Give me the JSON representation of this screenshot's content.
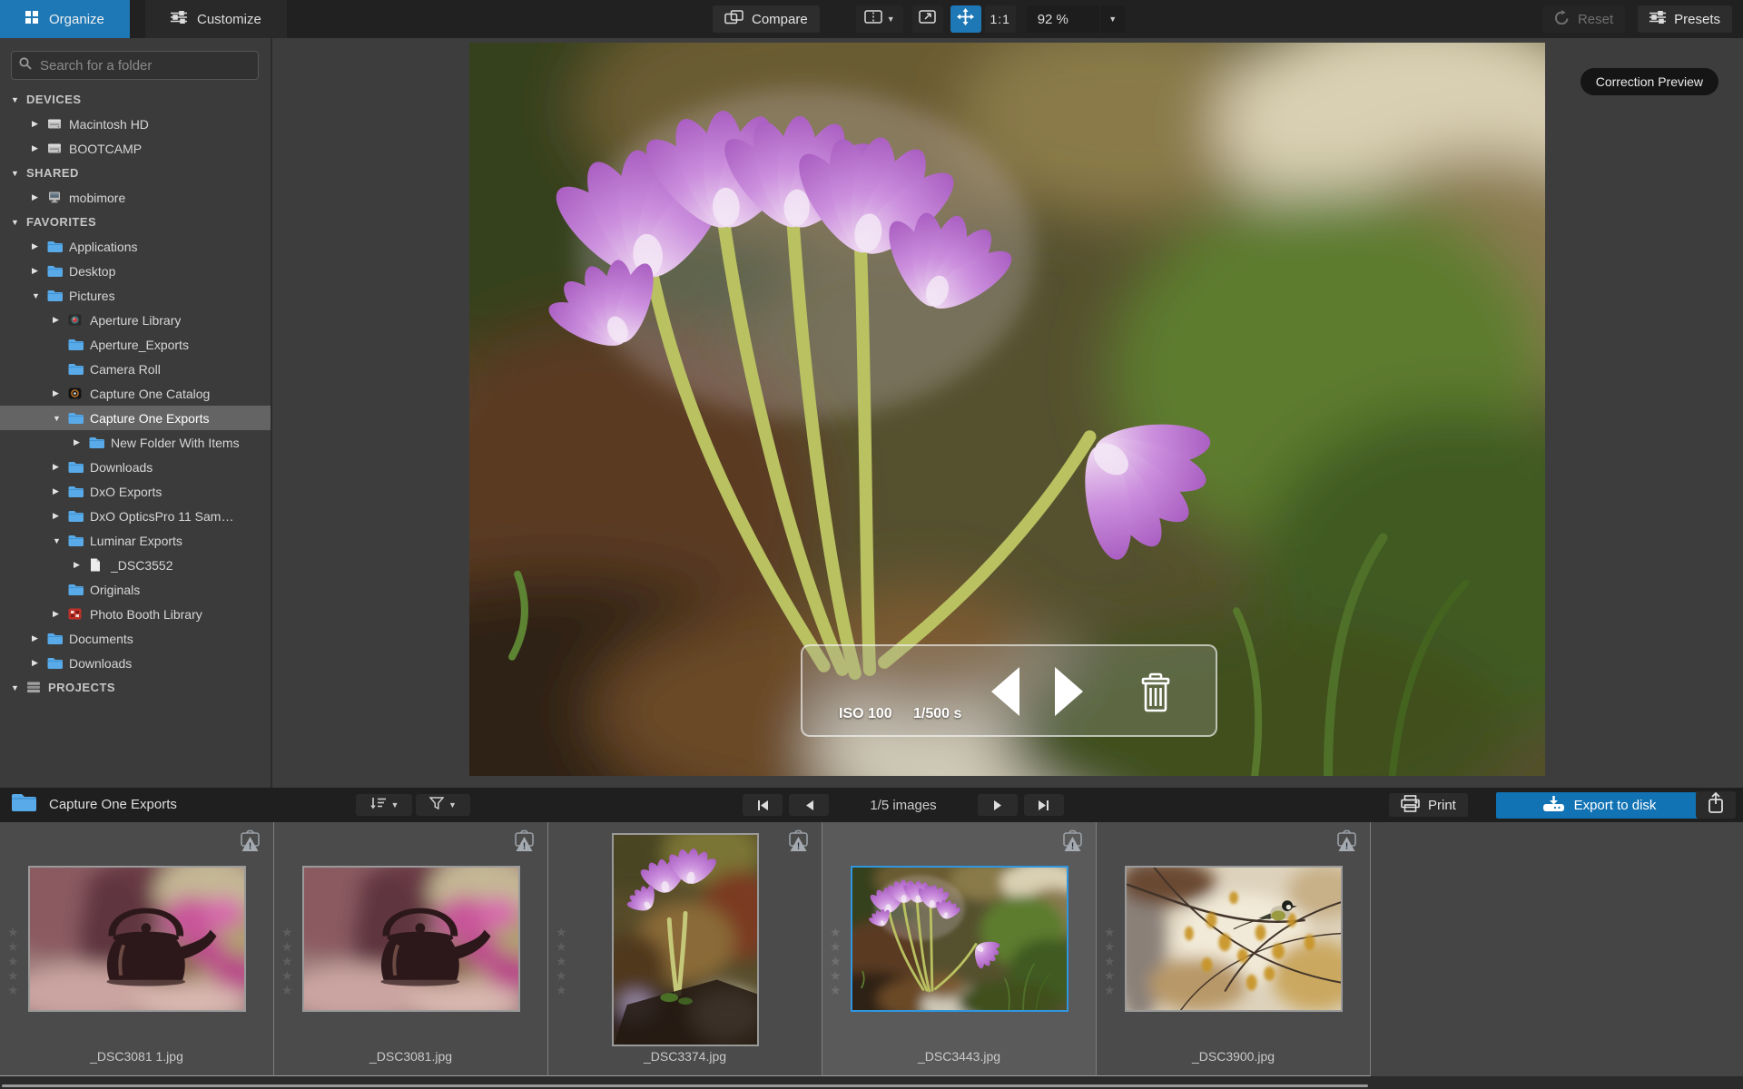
{
  "topbar": {
    "tabs": [
      {
        "label": "Organize",
        "icon": "grid-icon",
        "active": true
      },
      {
        "label": "Customize",
        "icon": "sliders-icon",
        "active": false
      }
    ],
    "compare_label": "Compare",
    "ratio_label": "1:1",
    "zoom_value": "92 %",
    "reset_label": "Reset",
    "presets_label": "Presets"
  },
  "sidebar": {
    "search_placeholder": "Search for a folder",
    "tree": [
      {
        "label": "DEVICES",
        "level": 0,
        "arrow": "down",
        "icon": "",
        "header": true
      },
      {
        "label": "Macintosh HD",
        "level": 1,
        "arrow": "right",
        "icon": "drive"
      },
      {
        "label": "BOOTCAMP",
        "level": 1,
        "arrow": "right",
        "icon": "drive"
      },
      {
        "label": "SHARED",
        "level": 0,
        "arrow": "down",
        "icon": "",
        "header": true
      },
      {
        "label": "mobimore",
        "level": 1,
        "arrow": "right",
        "icon": "display"
      },
      {
        "label": "FAVORITES",
        "level": 0,
        "arrow": "down",
        "icon": "",
        "header": true
      },
      {
        "label": "Applications",
        "level": 1,
        "arrow": "right",
        "icon": "folder"
      },
      {
        "label": "Desktop",
        "level": 1,
        "arrow": "right",
        "icon": "folder"
      },
      {
        "label": "Pictures",
        "level": 1,
        "arrow": "down",
        "icon": "folder"
      },
      {
        "label": "Aperture Library",
        "level": 2,
        "arrow": "right",
        "icon": "aperture"
      },
      {
        "label": "Aperture_Exports",
        "level": 2,
        "arrow": "",
        "icon": "folder"
      },
      {
        "label": "Camera Roll",
        "level": 2,
        "arrow": "",
        "icon": "folder"
      },
      {
        "label": "Capture One Catalog",
        "level": 2,
        "arrow": "right",
        "icon": "captureone"
      },
      {
        "label": "Capture One Exports",
        "level": 2,
        "arrow": "down",
        "icon": "folder",
        "selected": true
      },
      {
        "label": "New Folder With Items",
        "level": 3,
        "arrow": "right",
        "icon": "folder"
      },
      {
        "label": "Downloads",
        "level": 2,
        "arrow": "right",
        "icon": "folder"
      },
      {
        "label": "DxO Exports",
        "level": 2,
        "arrow": "right",
        "icon": "folder"
      },
      {
        "label": "DxO OpticsPro 11 Sam…",
        "level": 2,
        "arrow": "right",
        "icon": "folder"
      },
      {
        "label": "Luminar Exports",
        "level": 2,
        "arrow": "down",
        "icon": "folder"
      },
      {
        "label": "_DSC3552",
        "level": 3,
        "arrow": "right",
        "icon": "file"
      },
      {
        "label": "Originals",
        "level": 2,
        "arrow": "",
        "icon": "folder"
      },
      {
        "label": "Photo Booth Library",
        "level": 2,
        "arrow": "right",
        "icon": "photobooth"
      },
      {
        "label": "Documents",
        "level": 1,
        "arrow": "right",
        "icon": "folder"
      },
      {
        "label": "Downloads",
        "level": 1,
        "arrow": "right",
        "icon": "folder"
      },
      {
        "label": "PROJECTS",
        "level": 0,
        "arrow": "down",
        "icon": "projects",
        "header": true
      }
    ]
  },
  "viewer": {
    "correction_preview_label": "Correction Preview",
    "iso_label": "ISO 100",
    "shutter_label": "1/500 s"
  },
  "filmstrip_bar": {
    "folder_label": "Capture One Exports",
    "nav_count_label": "1/5 images",
    "print_label": "Print",
    "export_label": "Export to disk"
  },
  "filmstrip": {
    "items": [
      {
        "filename": "_DSC3081 1.jpg",
        "orientation": "landscape",
        "selected": false,
        "art": "teapot",
        "star_slots": 5
      },
      {
        "filename": "_DSC3081.jpg",
        "orientation": "landscape",
        "selected": false,
        "art": "teapot",
        "star_slots": 5
      },
      {
        "filename": "_DSC3374.jpg",
        "orientation": "portrait",
        "selected": false,
        "art": "crocusPortrait",
        "star_slots": 5
      },
      {
        "filename": "_DSC3443.jpg",
        "orientation": "landscape",
        "selected": true,
        "art": "crocusLandscape",
        "star_slots": 5
      },
      {
        "filename": "_DSC3900.jpg",
        "orientation": "landscape",
        "selected": false,
        "art": "bird",
        "star_slots": 5
      }
    ]
  },
  "colors": {
    "accent_blue": "#1e78b6",
    "export_blue": "#1173b4",
    "selected_row_gray": "#646464",
    "thumb_selected_border": "#2f97e0"
  }
}
